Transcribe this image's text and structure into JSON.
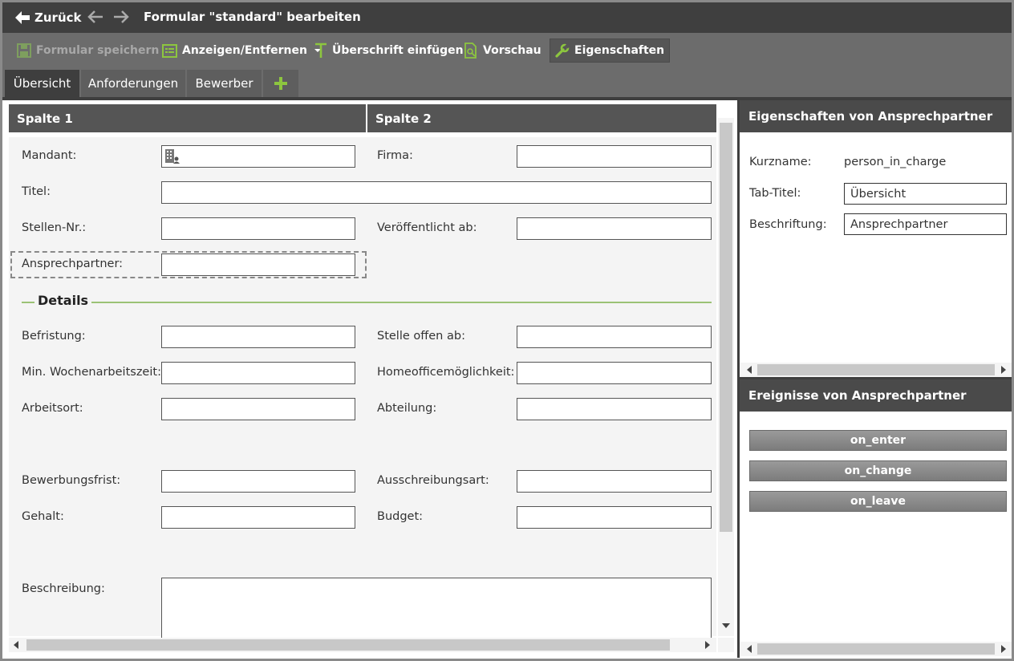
{
  "titlebar": {
    "back_label": "Zurück",
    "title": "Formular \"standard\" bearbeiten"
  },
  "toolbar": {
    "save_label": "Formular speichern",
    "show_hide_label": "Anzeigen/Entfernen",
    "insert_heading_label": "Überschrift einfügen",
    "preview_label": "Vorschau",
    "properties_label": "Eigenschaften"
  },
  "tabs": [
    {
      "label": "Übersicht",
      "active": true
    },
    {
      "label": "Anforderungen",
      "active": false
    },
    {
      "label": "Bewerber",
      "active": false
    }
  ],
  "columns": {
    "col1": "Spalte 1",
    "col2": "Spalte 2"
  },
  "form": {
    "mandant": "Mandant:",
    "firma": "Firma:",
    "titel": "Titel:",
    "stellen_nr": "Stellen-Nr.:",
    "veroeffentlicht_ab": "Veröffentlicht ab:",
    "ansprechpartner": "Ansprechpartner:",
    "details_title": "Details",
    "befristung": "Befristung:",
    "stelle_offen_ab": "Stelle offen ab:",
    "min_wochenarbeitszeit": "Min. Wochenarbeitszeit:",
    "homeoffice": "Homeofficemöglichkeit:",
    "arbeitsort": "Arbeitsort:",
    "abteilung": "Abteilung:",
    "bewerbungsfrist": "Bewerbungsfrist:",
    "ausschreibungsart": "Ausschreibungsart:",
    "gehalt": "Gehalt:",
    "budget": "Budget:",
    "beschreibung": "Beschreibung:"
  },
  "properties": {
    "header": "Eigenschaften von Ansprechpartner",
    "kurzname_label": "Kurzname:",
    "kurzname_value": "person_in_charge",
    "tab_titel_label": "Tab-Titel:",
    "tab_titel_value": "Übersicht",
    "beschriftung_label": "Beschriftung:",
    "beschriftung_value": "Ansprechpartner"
  },
  "events": {
    "header": "Ereignisse von Ansprechpartner",
    "buttons": [
      "on_enter",
      "on_change",
      "on_leave"
    ]
  },
  "colors": {
    "accent_green": "#8dc63f",
    "titlebar": "#3f3f3f",
    "toolbar": "#6c6c6c"
  }
}
